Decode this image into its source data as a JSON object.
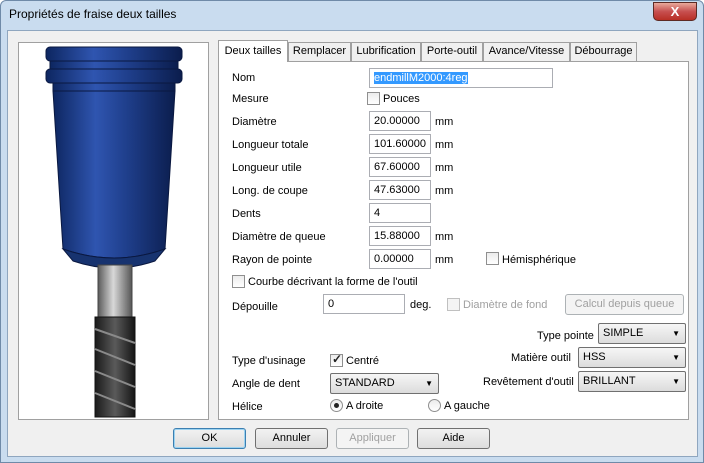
{
  "window": {
    "title": "Propriétés de fraise deux tailles",
    "close_label": "X"
  },
  "tabs": [
    {
      "label": "Deux tailles"
    },
    {
      "label": "Remplacer"
    },
    {
      "label": "Lubrification"
    },
    {
      "label": "Porte-outil"
    },
    {
      "label": "Avance/Vitesse"
    },
    {
      "label": "Débourrage"
    }
  ],
  "form": {
    "nom_label": "Nom",
    "nom_value": "endmillM2000:4reg",
    "mesure_label": "Mesure",
    "pouces_label": "Pouces",
    "diametre_label": "Diamètre",
    "diametre_value": "20.00000",
    "longueur_totale_label": "Longueur totale",
    "longueur_totale_value": "101.60000",
    "longueur_utile_label": "Longueur utile",
    "longueur_utile_value": "67.60000",
    "long_coupe_label": "Long. de coupe",
    "long_coupe_value": "47.63000",
    "dents_label": "Dents",
    "dents_value": "4",
    "diametre_queue_label": "Diamètre de queue",
    "diametre_queue_value": "15.88000",
    "rayon_pointe_label": "Rayon de pointe",
    "rayon_pointe_value": "0.00000",
    "unit_mm": "mm",
    "hemispherique_label": "Hémisphérique",
    "courbe_label": "Courbe décrivant la forme de l'outil",
    "depouille_label": "Dépouille",
    "depouille_value": "0",
    "unit_deg": "deg.",
    "diametre_fond_label": "Diamètre de fond",
    "calcul_button": "Calcul depuis queue",
    "type_pointe_label": "Type pointe",
    "type_pointe_value": "SIMPLE",
    "type_usinage_label": "Type d'usinage",
    "centre_label": "Centré",
    "matiere_label": "Matière outil",
    "matiere_value": "HSS",
    "angle_dent_label": "Angle de dent",
    "angle_dent_value": "STANDARD",
    "revetement_label": "Revêtement d'outil",
    "revetement_value": "BRILLANT",
    "helice_label": "Hélice",
    "a_droite_label": "A droite",
    "a_gauche_label": "A gauche"
  },
  "buttons": {
    "ok": "OK",
    "annuler": "Annuler",
    "appliquer": "Appliquer",
    "aide": "Aide"
  },
  "colors": {
    "tool_holder": "#1f3f8c",
    "shank": "#8a8a8a",
    "flutes": "#2a2a2a",
    "frame": "#c9dcef"
  }
}
